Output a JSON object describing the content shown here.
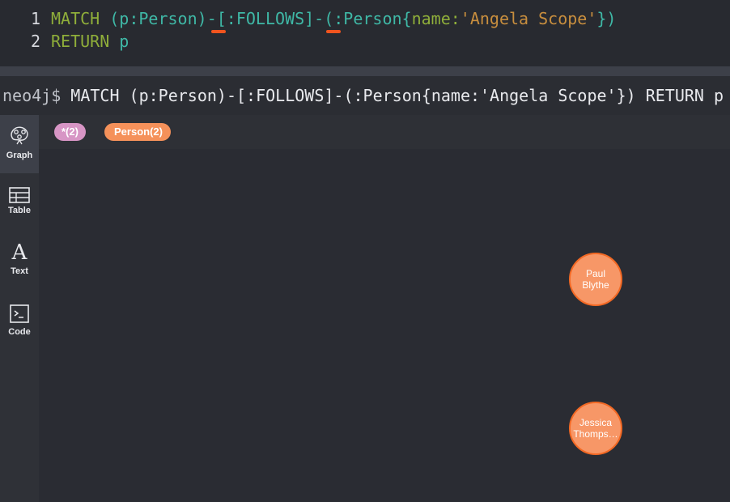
{
  "editor": {
    "line1_num": "1",
    "line2_num": "2",
    "line1": {
      "match": "MATCH",
      "open_node": "(p:Person)",
      "dash1": "-",
      "rel": "[:FOLLOWS]",
      "dash2": "-",
      "node2_open": "(:Person{",
      "prop_key": "name:",
      "prop_val": "'Angela Scope'",
      "node2_close": "})"
    },
    "line2": {
      "ret": "RETURN",
      "var": "p"
    },
    "error_color": "#f0541e"
  },
  "frame": {
    "prompt": "neo4j$",
    "command": "MATCH (p:Person)-[:FOLLOWS]-(:Person{name:'Angela Scope'}) RETURN p"
  },
  "sidebar": {
    "items": [
      {
        "label": "Graph",
        "icon": "graph-icon",
        "active": true
      },
      {
        "label": "Table",
        "icon": "table-icon"
      },
      {
        "label": "Text",
        "icon": "text-icon",
        "glyph": "A"
      },
      {
        "label": "Code",
        "icon": "code-icon"
      }
    ]
  },
  "legend": {
    "relationships": "*(2)",
    "relationships_color": "#d795c5",
    "labels": "Person(2)",
    "labels_color": "#f5915a"
  },
  "graph": {
    "nodes": [
      {
        "label": "Paul Blythe",
        "line1": "Paul",
        "line2": "Blythe"
      },
      {
        "label": "Jessica Thomps…",
        "line1": "Jessica",
        "line2": "Thomps…"
      }
    ],
    "node_color": "#f79767",
    "node_border": "#f36924"
  }
}
